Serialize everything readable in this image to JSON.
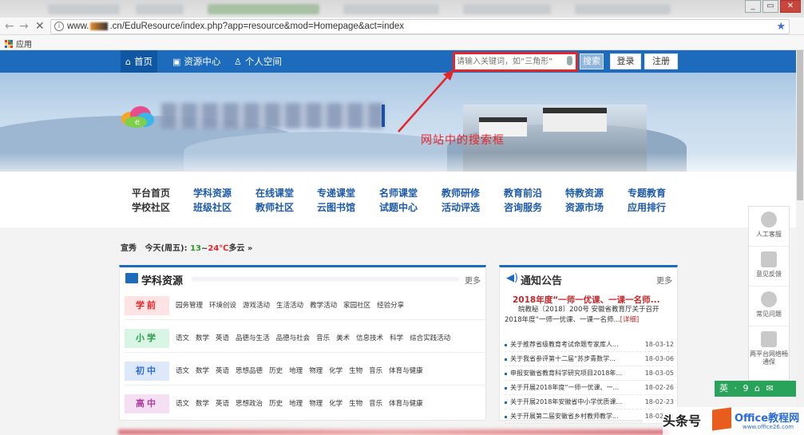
{
  "browser": {
    "url_prefix": "www.",
    "url_suffix": ".cn/EduResource/index.php?app=resource&mod=Homepage&act=index",
    "bookmark_apps": "应用",
    "win_minimize": "_",
    "win_restore": "▭",
    "win_close": "✕"
  },
  "topnav": {
    "items": [
      "首页",
      "资源中心",
      "个人空间"
    ],
    "search_placeholder": "请输入关键词，如“三角形”",
    "search_button": "搜索",
    "login_button": "登录",
    "register_button": "注册"
  },
  "banner": {
    "annotation": "网站中的搜索框"
  },
  "menu": {
    "columns": [
      {
        "a": "平台首页",
        "b": "学校社区"
      },
      {
        "a": "学科资源",
        "b": "班级社区"
      },
      {
        "a": "在线课堂",
        "b": "教师社区"
      },
      {
        "a": "专递课堂",
        "b": "云图书馆"
      },
      {
        "a": "名师课堂",
        "b": "试题中心"
      },
      {
        "a": "教师研修",
        "b": "活动评选"
      },
      {
        "a": "教育前沿",
        "b": "咨询服务"
      },
      {
        "a": "特教资源",
        "b": "资源市场"
      },
      {
        "a": "专题教育",
        "b": "应用排行"
      }
    ]
  },
  "weather": {
    "city": "宣秀",
    "day": "今天(周五):",
    "low": "13",
    "sep": "~",
    "high": "24℃",
    "cond": "多云 »"
  },
  "subjects": {
    "title": "学科资源",
    "more": "更多",
    "rows": [
      {
        "tag": "学前",
        "tag_color": "#e3262a",
        "tag_bg": "#fde3e3",
        "links": [
          "园务管理",
          "环境创设",
          "游戏活动",
          "生活活动",
          "教学活动",
          "家园社区",
          "经验分享"
        ]
      },
      {
        "tag": "小学",
        "tag_color": "#2a9a4a",
        "tag_bg": "#d9f5e3",
        "links": [
          "语文",
          "数学",
          "英语",
          "品德与生活",
          "品德与社会",
          "音乐",
          "美术",
          "信息技术",
          "科学",
          "综合实践活动"
        ]
      },
      {
        "tag": "初中",
        "tag_color": "#2a6bd6",
        "tag_bg": "#dde9fb",
        "links": [
          "语文",
          "数学",
          "英语",
          "思想品德",
          "历史",
          "地理",
          "物理",
          "化学",
          "生物",
          "音乐",
          "体育与健康"
        ]
      },
      {
        "tag": "高中",
        "tag_color": "#b03aa0",
        "tag_bg": "#f5dff2",
        "links": [
          "语文",
          "数学",
          "英语",
          "思想政治",
          "历史",
          "地理",
          "物理",
          "化学",
          "生物",
          "音乐",
          "体育与健康"
        ]
      }
    ]
  },
  "notices": {
    "title": "通知公告",
    "more": "更多",
    "feature_title": "2018年度“一师一优课、一课一名师...",
    "feature_body": "皖教秘〔2018〕200号 安徽省教育厅关于召开2018年度“一师一优课、一课一名师...",
    "feature_link": "[详细]",
    "items": [
      {
        "text": "关于推荐省级教育考试命题专家库人...",
        "date": "18-03-12"
      },
      {
        "text": "关于我省参评第十二届“苏步青数学...",
        "date": "18-03-06"
      },
      {
        "text": "申报安徽省教育科学研究项目2018年...",
        "date": "18-03-05"
      },
      {
        "text": "关于开展2018年度“一师一优课、一...",
        "date": "18-02-26"
      },
      {
        "text": "关于开展2018年安徽省中小学优质课...",
        "date": "18-02-23"
      },
      {
        "text": "关于开展第二届安徽省乡村教师教学...",
        "date": "18-02-08"
      }
    ]
  },
  "sidebar": {
    "items": [
      "人工客服",
      "意见反馈",
      "常见问题",
      "两平台网络畅通保"
    ]
  },
  "greenbar": "英 · 9 ⌂ ✉",
  "watermark": {
    "text": "头条号",
    "brand": "Office教程网",
    "url": "www.office26.com"
  },
  "colors": {
    "nav_blue": "#1c6bbd",
    "annotation_red": "#e3262a"
  }
}
